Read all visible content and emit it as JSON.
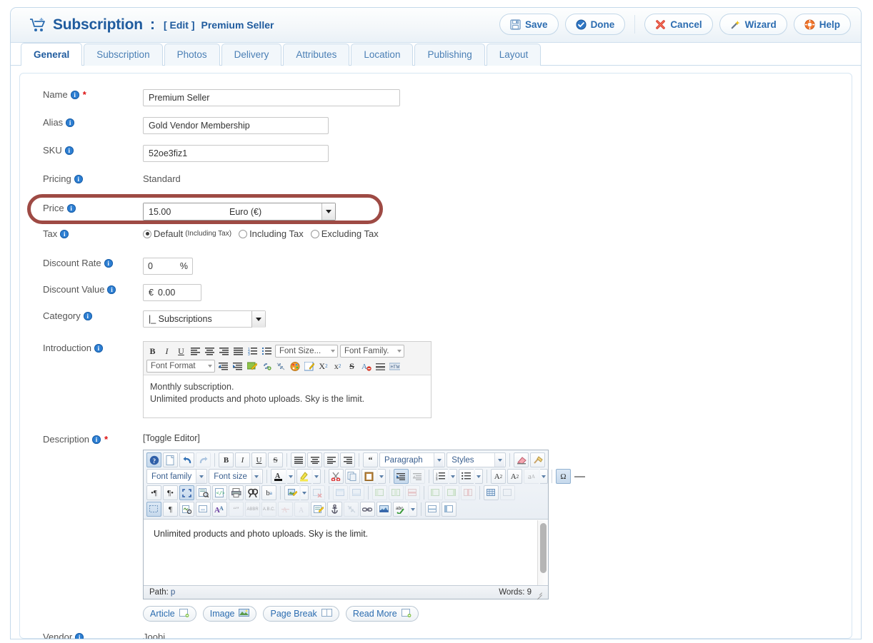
{
  "header": {
    "icon": "shopping-cart-icon",
    "title": "Subscription",
    "colon": ":",
    "edit_tag": "[ Edit ]",
    "record_name": "Premium Seller",
    "accent": "#1f5b9e"
  },
  "toolbar": {
    "buttons": [
      {
        "label": "Save",
        "icon": "floppy-disk-icon"
      },
      {
        "label": "Done",
        "icon": "check-circle-icon"
      },
      {
        "label": "Cancel",
        "icon": "red-x-icon"
      },
      {
        "label": "Wizard",
        "icon": "magic-wand-icon"
      },
      {
        "label": "Help",
        "icon": "life-ring-icon"
      }
    ]
  },
  "tabs": [
    {
      "label": "General",
      "active": true
    },
    {
      "label": "Subscription",
      "active": false
    },
    {
      "label": "Photos",
      "active": false
    },
    {
      "label": "Delivery",
      "active": false
    },
    {
      "label": "Attributes",
      "active": false
    },
    {
      "label": "Location",
      "active": false
    },
    {
      "label": "Publishing",
      "active": false
    },
    {
      "label": "Layout",
      "active": false
    }
  ],
  "form": {
    "name": {
      "label": "Name",
      "required": true,
      "value": "Premium Seller"
    },
    "alias": {
      "label": "Alias",
      "required": false,
      "value": "Gold Vendor Membership"
    },
    "sku": {
      "label": "SKU",
      "required": false,
      "value": "52oe3fiz1"
    },
    "pricing": {
      "label": "Pricing",
      "value": "Standard"
    },
    "price": {
      "label": "Price",
      "value": "15.00",
      "currency": "Euro (€)"
    },
    "tax": {
      "label": "Tax",
      "options": [
        {
          "label": "Default",
          "note": "(Including Tax)",
          "selected": true
        },
        {
          "label": "Including Tax",
          "note": "",
          "selected": false
        },
        {
          "label": "Excluding Tax",
          "note": "",
          "selected": false
        }
      ]
    },
    "discount_rate": {
      "label": "Discount Rate",
      "value": "0",
      "suffix": "%"
    },
    "discount_value": {
      "label": "Discount Value",
      "prefix": "€",
      "value": "0.00"
    },
    "category": {
      "label": "Category",
      "value": "|_  Subscriptions"
    },
    "introduction": {
      "label": "Introduction",
      "toolbar_selects": [
        "Font Size...",
        "Font Family.",
        "Font Format"
      ],
      "lines": [
        "Monthly subscription.",
        "Unlimited products and photo uploads. Sky is the limit."
      ]
    },
    "description": {
      "label": "Description",
      "required": true,
      "toggle_editor": "[Toggle Editor]",
      "selects": {
        "paragraph": "Paragraph",
        "styles": "Styles",
        "font_family": "Font family",
        "font_size": "Font size"
      },
      "content": "Unlimited products and photo uploads. Sky is the limit.",
      "status_path_label": "Path:",
      "status_path_value": "p",
      "status_words": "Words: 9",
      "insert_buttons": [
        {
          "label": "Article",
          "icon": "article-icon"
        },
        {
          "label": "Image",
          "icon": "image-icon"
        },
        {
          "label": "Page Break",
          "icon": "page-break-icon"
        },
        {
          "label": "Read More",
          "icon": "read-more-icon"
        }
      ]
    },
    "vendor": {
      "label": "Vendor",
      "value": "Joobi"
    }
  },
  "annotation": {
    "target": "price-row",
    "color": "#9e4a44"
  }
}
